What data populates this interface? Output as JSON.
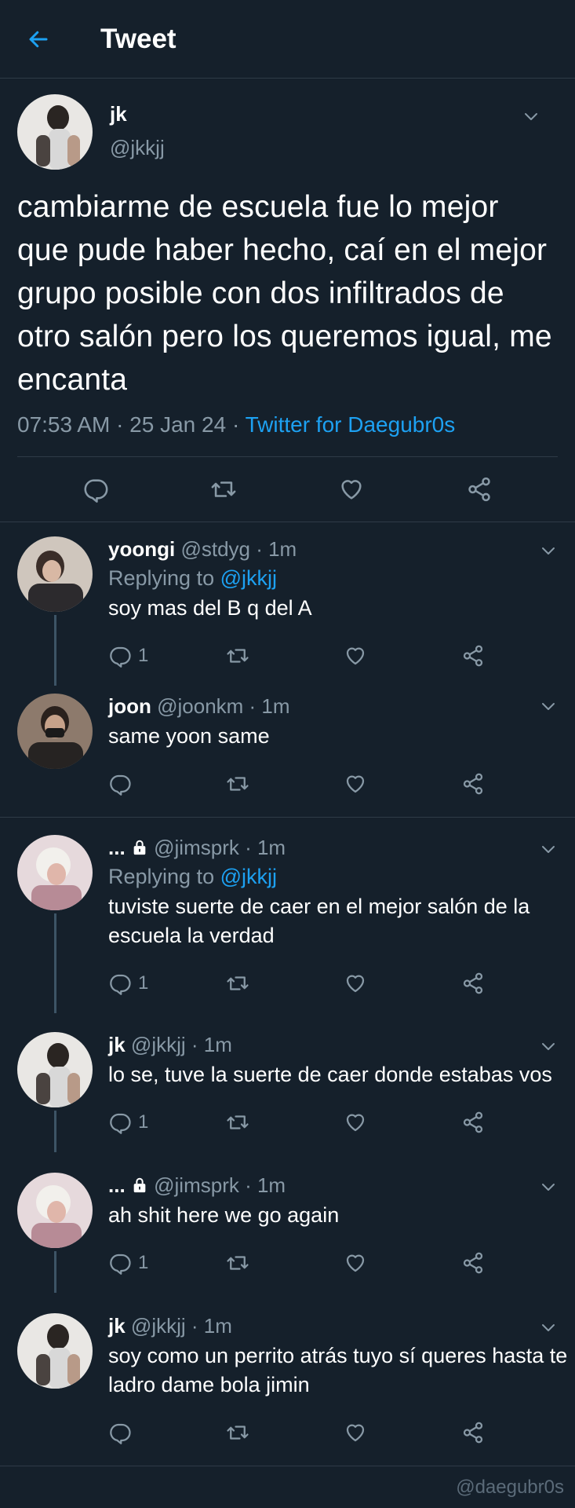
{
  "header": {
    "title": "Tweet"
  },
  "main": {
    "name": "jk",
    "handle": "@jkkjj",
    "text": "cambiarme de escuela fue lo mejor que pude haber hecho, caí en el mejor grupo posible con dos infiltrados de otro salón pero los queremos igual, me encanta",
    "time": "07:53 AM · 25 Jan 24 · ",
    "source": "Twitter for Daegubr0s"
  },
  "replies": [
    {
      "name": "yoongi",
      "handle": "@stdyg · 1m",
      "replying_prefix": "Replying to ",
      "replying_to": "@jkkjj",
      "text": "soy mas del B q del A",
      "count": "1"
    },
    {
      "name": "joon",
      "handle": "@joonkm · 1m",
      "text": "same yoon same",
      "count": ""
    },
    {
      "name": "...",
      "handle": " @jimsprk · 1m",
      "replying_prefix": "Replying to ",
      "replying_to": "@jkkjj",
      "text": "tuviste suerte de caer en el mejor salón de la escuela la verdad",
      "count": "1"
    },
    {
      "name": "jk",
      "handle": "@jkkjj · 1m",
      "text": "lo se, tuve la suerte de caer donde estabas vos",
      "count": "1"
    },
    {
      "name": "...",
      "handle": " @jimsprk · 1m",
      "text": "ah shit here we go again",
      "count": "1"
    },
    {
      "name": "jk",
      "handle": "@jkkjj · 1m",
      "text": "soy como un perrito atrás tuyo sí queres hasta te ladro dame bola jimin",
      "count": ""
    }
  ],
  "watermark": "@daegubr0s",
  "colors": {
    "background": "#15202b",
    "accent": "#1da1f2",
    "muted": "#8899a6"
  }
}
